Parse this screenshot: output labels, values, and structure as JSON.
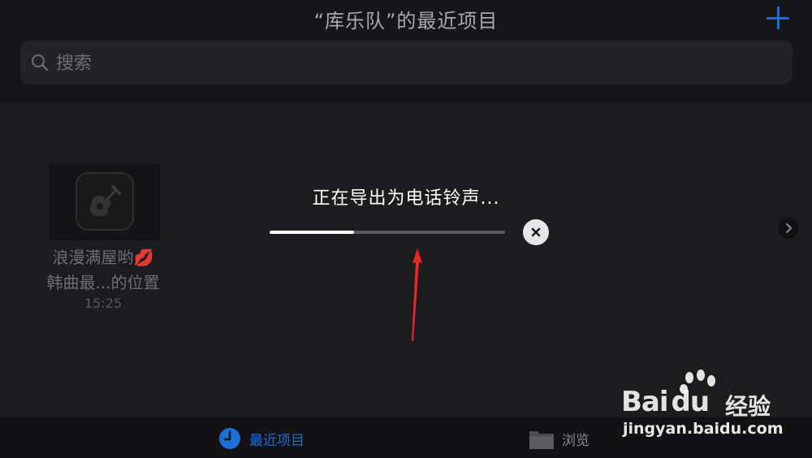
{
  "header": {
    "title": "“库乐队”的最近项目",
    "add_icon": "plus-icon"
  },
  "search": {
    "placeholder": "搜索",
    "value": "",
    "icon": "search-icon"
  },
  "project": {
    "name_line1": "浪漫满屋哟💋",
    "name_line2": "韩曲最...的位置",
    "time": "15:25",
    "icon": "guitar-icon"
  },
  "export": {
    "label": "正在导出为电话铃声...",
    "progress": 0.36,
    "cancel_icon": "close-icon"
  },
  "tabbar": {
    "recent_label": "最近项目",
    "browse_label": "浏览",
    "recent_icon": "clock-icon",
    "browse_icon": "folder-icon"
  },
  "watermark": {
    "brand": "Bai",
    "brand_tail": "du",
    "product": "经验",
    "url": "jingyan.baidu.com"
  },
  "colors": {
    "accent": "#1c6fd6",
    "background": "#1c1c1e",
    "annotation_arrow": "#e8262b"
  }
}
